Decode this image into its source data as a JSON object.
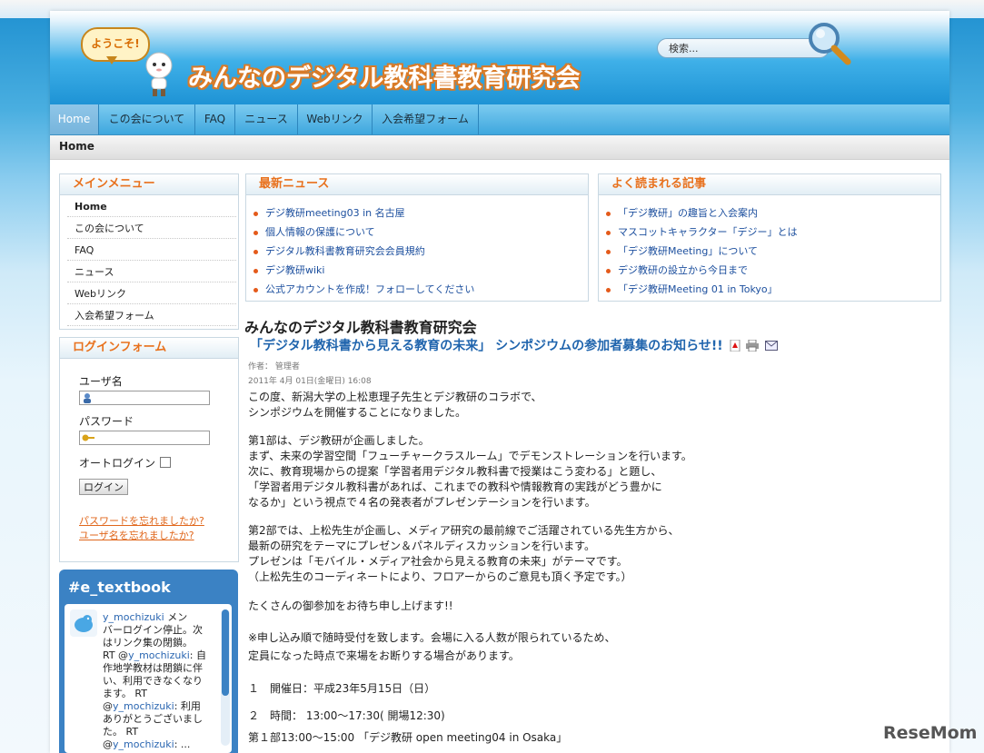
{
  "header": {
    "welcome": "ようこそ!",
    "site_title": "みんなのデジタル教科書教育研究会",
    "search_placeholder": "検索..."
  },
  "nav": {
    "items": [
      "Home",
      "この会について",
      "FAQ",
      "ニュース",
      "Webリンク",
      "入会希望フォーム"
    ]
  },
  "breadcrumb": "Home",
  "main_menu": {
    "title": "メインメニュー",
    "items": [
      "Home",
      "この会について",
      "FAQ",
      "ニュース",
      "Webリンク",
      "入会希望フォーム"
    ]
  },
  "login": {
    "title": "ログインフォーム",
    "username_label": "ユーザ名",
    "password_label": "パスワード",
    "autologin_label": "オートログイン",
    "login_button": "ログイン",
    "forgot_password": "パスワードを忘れましたか?",
    "forgot_username": "ユーザ名を忘れましたか?"
  },
  "twitter": {
    "title": "#e_textbook",
    "user": "y_mochizuki",
    "lines": [
      "メン",
      "バーログイン停止。次",
      "はリンク集の閉鎖。",
      "RT @",
      "自",
      "作地学教材は閉鎖に伴",
      "い、利用できなくなり",
      "ます。 RT",
      "@",
      ": 利用",
      "ありがとうございまし",
      "た。 RT",
      "@",
      ": ..."
    ]
  },
  "latest_news": {
    "title": "最新ニュース",
    "items": [
      "デジ教研meeting03 in 名古屋",
      "個人情報の保護について",
      "デジタル教科書教育研究会会員規約",
      "デジ教研wiki",
      "公式アカウントを作成！フォローしてください"
    ]
  },
  "popular": {
    "title": "よく読まれる記事",
    "items": [
      "「デジ教研」の趣旨と入会案内",
      "マスコットキャラクター「デジー」とは",
      "「デジ教研Meeting」について",
      "デジ教研の設立から今日まで",
      "「デジ教研Meeting 01 in Tokyo」"
    ]
  },
  "article": {
    "site_name": "みんなのデジタル教科書教育研究会",
    "title": "「デジタル教科書から見える教育の未来」 シンポジウムの参加者募集のお知らせ!!",
    "author": "作者： 管理者",
    "date": "2011年 4月 01日(金曜日) 16:08",
    "paragraphs": [
      "この度、新潟大学の上松恵理子先生とデジ教研のコラボで、",
      "シンポジウムを開催することになりました。",
      "第1部は、デジ教研が企画しました。",
      "まず、未来の学習空間「フューチャークラスルーム」でデモンストレーションを行います。",
      "次に、教育現場からの提案「学習者用デジタル教科書で授業はこう変わる」と題し、",
      "「学習者用デジタル教科書があれば、これまでの教科や情報教育の実践がどう豊かに",
      "なるか」という視点で４名の発表者がプレゼンテーションを行います。",
      "第2部では、上松先生が企画し、メディア研究の最前線でご活躍されている先生方から、",
      "最新の研究をテーマにプレゼン＆パネルディスカッションを行います。",
      "プレゼンは「モバイル・メディア社会から見える教育の未来」がテーマです。",
      "（上松先生のコーディネートにより、フロアーからのご意見も頂く予定です。）",
      "たくさんの御参加をお待ち申し上げます!!",
      "※申し込み順で随時受付を致します。会場に入る人数が限られているため、",
      "定員になった時点で来場をお断りする場合があります。",
      "１　開催日：平成23年5月15日（日）",
      "２　時間：  13:00〜17:30( 開場12:30)",
      "第１部13:00〜15:00 「デジ教研 open meeting04 in Osaka」"
    ]
  },
  "watermark": "ReseMom"
}
